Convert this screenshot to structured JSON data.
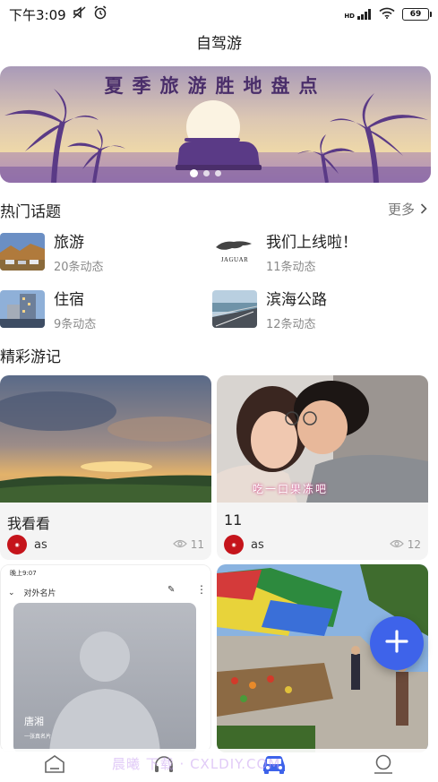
{
  "status_bar": {
    "time": "下午3:09",
    "network": "HD",
    "battery": "69"
  },
  "title": "自驾游",
  "banner": {
    "text": "夏季旅游胜地盘点"
  },
  "hot_topics": {
    "title": "热门话题",
    "more": "更多",
    "items": [
      {
        "name": "旅游",
        "count": "20条动态"
      },
      {
        "name": "我们上线啦！",
        "count": "11条动态",
        "logo_text": "JAGUAR"
      },
      {
        "name": "住宿",
        "count": "9条动态"
      },
      {
        "name": "滨海公路",
        "count": "12条动态"
      }
    ]
  },
  "travelogues": {
    "title": "精彩游记",
    "cards": [
      {
        "title": "我看看",
        "user": "as",
        "views": "11"
      },
      {
        "title": "11",
        "user": "as",
        "views": "12",
        "image_caption": "吃一口果冻吧"
      }
    ],
    "card3_screenshot": {
      "time": "晚上9:07",
      "header": "对外名片",
      "person_name": "唐湘",
      "person_sub": "一张真名片"
    }
  },
  "bottom_nav": {
    "watermark": "晨曦 下载 · CXLDIY.COM"
  },
  "colors": {
    "accent": "#3e63ea",
    "avatar_red": "#c5141b",
    "banner_purple": "#4a2e6a"
  }
}
